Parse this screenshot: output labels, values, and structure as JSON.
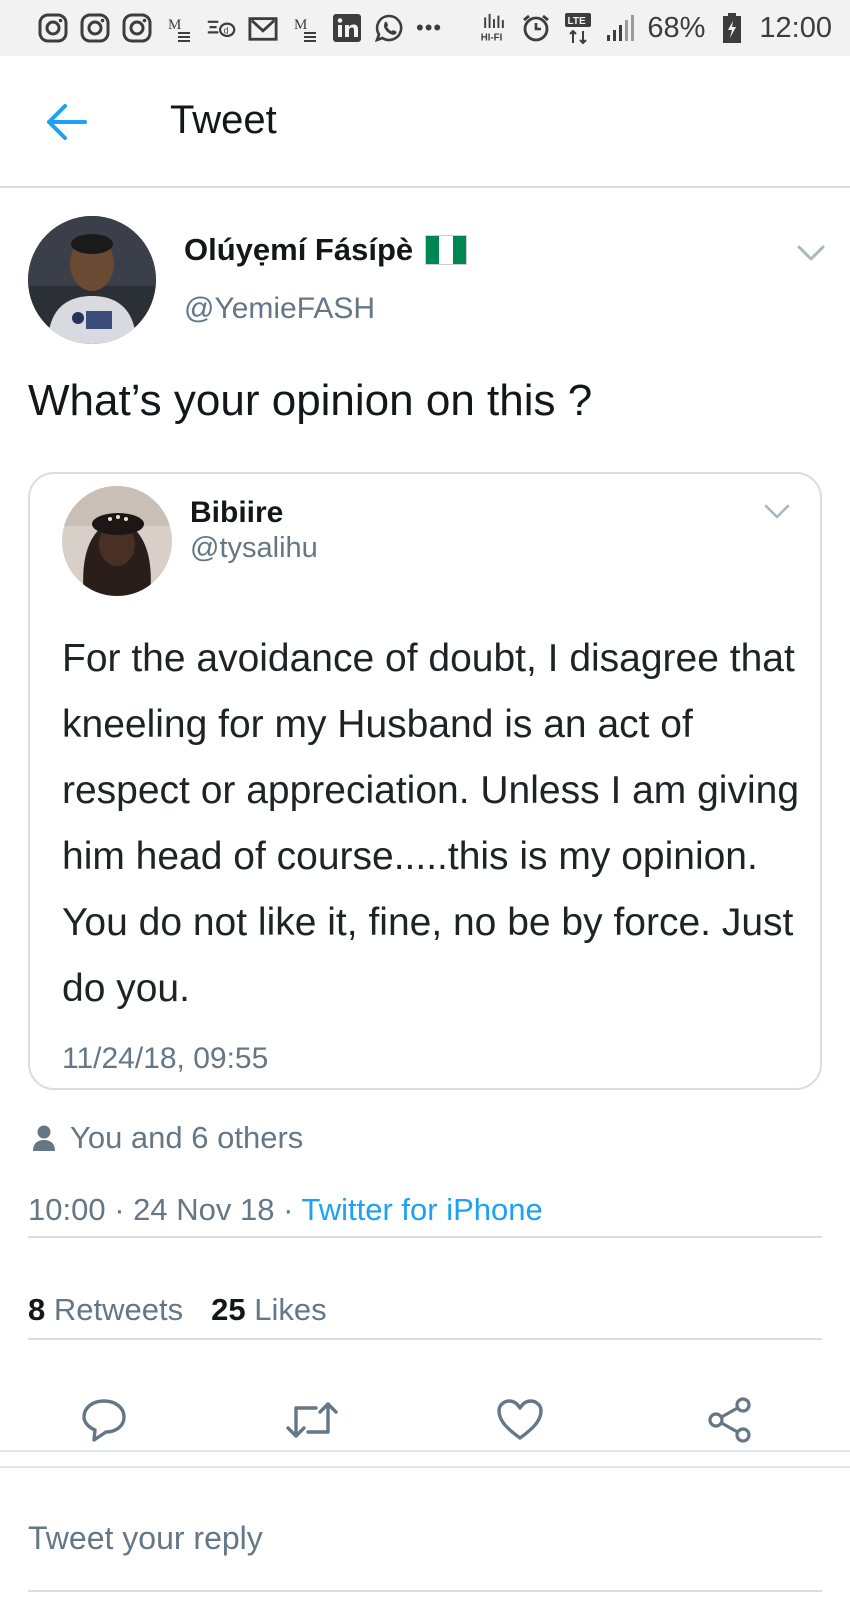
{
  "status_bar": {
    "battery": "68%",
    "time": "12:00",
    "network": "LTE",
    "hifi": "HI-FI",
    "left_icons": [
      "instagram-icon",
      "instagram-icon",
      "instagram-icon",
      "gmail-icon",
      "fuzzy-mail-icon",
      "gmail-box-icon",
      "gmail-icon",
      "linkedin-icon",
      "whatsapp-icon",
      "more-dots-icon"
    ],
    "more_dots": "•••"
  },
  "header": {
    "title": "Tweet",
    "back_icon": "arrow-left-icon",
    "accent": "#1da1f2"
  },
  "tweet": {
    "author_name": "Olúyẹmí Fásípè",
    "author_handle": "@YemieFASH",
    "author_flag": "nigeria-flag",
    "text": "What’s your opinion on this ?",
    "quoted": {
      "name": "Bibiire",
      "handle": "@tysalihu",
      "text": "For the avoidance of doubt, I disagree that kneeling for my Husband is an act of respect or appreciation. Unless I am giving him head of course.....this is my opinion. You do not like it, fine, no be by force. Just do you.",
      "timestamp": "11/24/18, 09:55"
    },
    "liked_by": "You and 6 others",
    "time": "10:00",
    "date": "24 Nov 18",
    "separator": "·",
    "source": "Twitter for iPhone",
    "retweets_count": "8",
    "retweets_label": "Retweets",
    "likes_count": "25",
    "likes_label": "Likes"
  },
  "actions": {
    "icons": [
      "reply-icon",
      "retweet-icon",
      "like-icon",
      "share-icon"
    ]
  },
  "reply": {
    "placeholder": "Tweet your reply"
  },
  "colors": {
    "accent": "#1da1f2",
    "secondary_text": "#657786",
    "primary_text": "#14171a",
    "divider": "#d6dde3",
    "flag_green": "#008751"
  }
}
